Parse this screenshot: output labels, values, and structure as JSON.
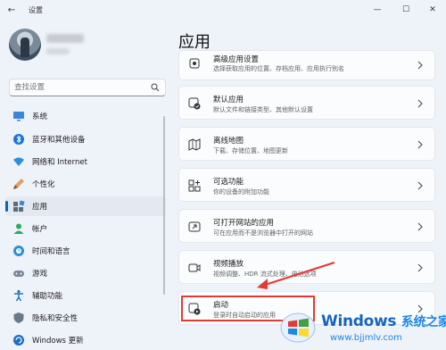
{
  "window": {
    "title": "设置",
    "controls": {
      "minimize": "—",
      "maximize": "☐",
      "close": "✕"
    }
  },
  "search": {
    "placeholder": "查找设置"
  },
  "sidebar": {
    "items": [
      {
        "label": "系统",
        "icon": "monitor-icon"
      },
      {
        "label": "蓝牙和其他设备",
        "icon": "bluetooth-icon"
      },
      {
        "label": "网络和 Internet",
        "icon": "wifi-icon"
      },
      {
        "label": "个性化",
        "icon": "brush-icon"
      },
      {
        "label": "应用",
        "icon": "apps-icon",
        "active": true
      },
      {
        "label": "帐户",
        "icon": "person-icon"
      },
      {
        "label": "时间和语言",
        "icon": "globe-clock-icon"
      },
      {
        "label": "游戏",
        "icon": "gamepad-icon"
      },
      {
        "label": "辅助功能",
        "icon": "accessibility-icon"
      },
      {
        "label": "隐私和安全性",
        "icon": "shield-icon"
      },
      {
        "label": "Windows 更新",
        "icon": "update-icon"
      }
    ]
  },
  "main": {
    "title": "应用",
    "cards": [
      {
        "title": "高级应用设置",
        "subtitle": "选择获取应用的位置、存档应用、应用执行别名",
        "icon": "advanced-apps-icon"
      },
      {
        "title": "默认应用",
        "subtitle": "默认文件和链接类型、其他默认设置",
        "icon": "default-apps-icon"
      },
      {
        "title": "离线地图",
        "subtitle": "下载、存储位置、地图更新",
        "icon": "map-icon"
      },
      {
        "title": "可选功能",
        "subtitle": "你的设备的附加功能",
        "icon": "optional-features-icon"
      },
      {
        "title": "可打开网站的应用",
        "subtitle": "可在应用而不是浏览器中打开的网站",
        "icon": "web-apps-icon"
      },
      {
        "title": "视频播放",
        "subtitle": "视频调整、HDR 流式处理、电池选项",
        "icon": "video-icon"
      },
      {
        "title": "启动",
        "subtitle": "登录时自动启动的应用",
        "icon": "startup-icon"
      }
    ]
  },
  "watermark": {
    "brand": "Windows",
    "brand_cn": "系统之家",
    "url": "www.bjjmlv.com"
  },
  "colors": {
    "accent": "#0067c0",
    "highlight": "#e53935"
  }
}
